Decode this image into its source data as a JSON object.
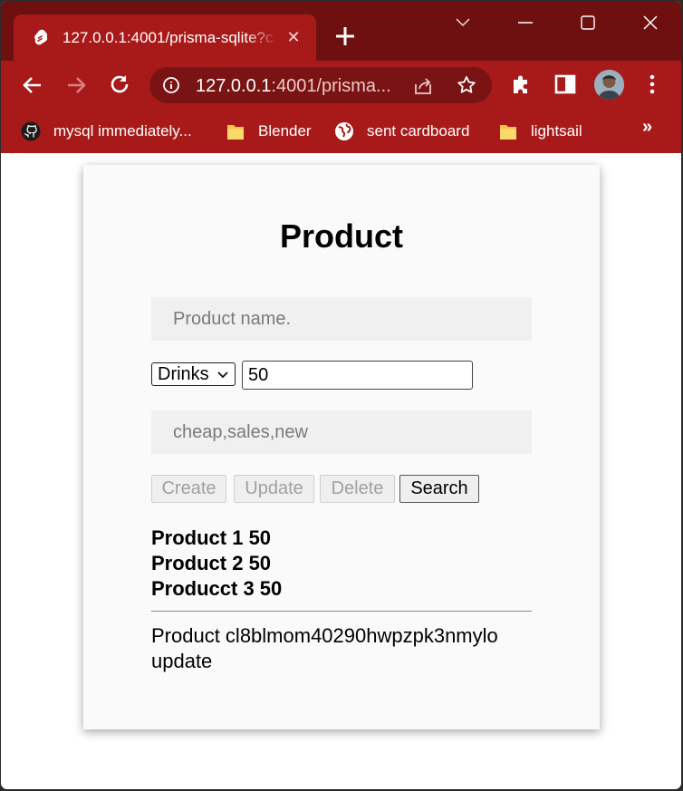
{
  "browser": {
    "tab": {
      "title": "127.0.0.1:4001/prisma-sqlite?c",
      "favicon": "svelte-icon"
    },
    "omnibox": {
      "host": "127.0.0.1",
      "rest": ":4001/prisma..."
    },
    "bookmarks": [
      {
        "label": "mysql immediately...",
        "icon": "github-icon"
      },
      {
        "label": "Blender",
        "icon": "folder-icon"
      },
      {
        "label": "sent cardboard",
        "icon": "globe-icon"
      },
      {
        "label": "lightsail",
        "icon": "folder-icon"
      }
    ],
    "bookmarks_more": "»",
    "colors": {
      "frame": "#6e1010",
      "toolbar": "#a81a1a",
      "omnibox": "#7a1313"
    }
  },
  "form": {
    "title": "Product",
    "name_placeholder": "Product name.",
    "name_value": "",
    "category_selected": "Drinks",
    "price_value": "50",
    "tags_placeholder": "cheap,sales,new",
    "tags_value": "",
    "buttons": {
      "create": "Create",
      "update": "Update",
      "delete": "Delete",
      "search": "Search"
    }
  },
  "products": [
    "Product 1 50",
    "Product 2 50",
    "Producct 3 50"
  ],
  "status": {
    "line1": "Product cl8blmom40290hwpzpk3nmylo",
    "line2": "update"
  }
}
